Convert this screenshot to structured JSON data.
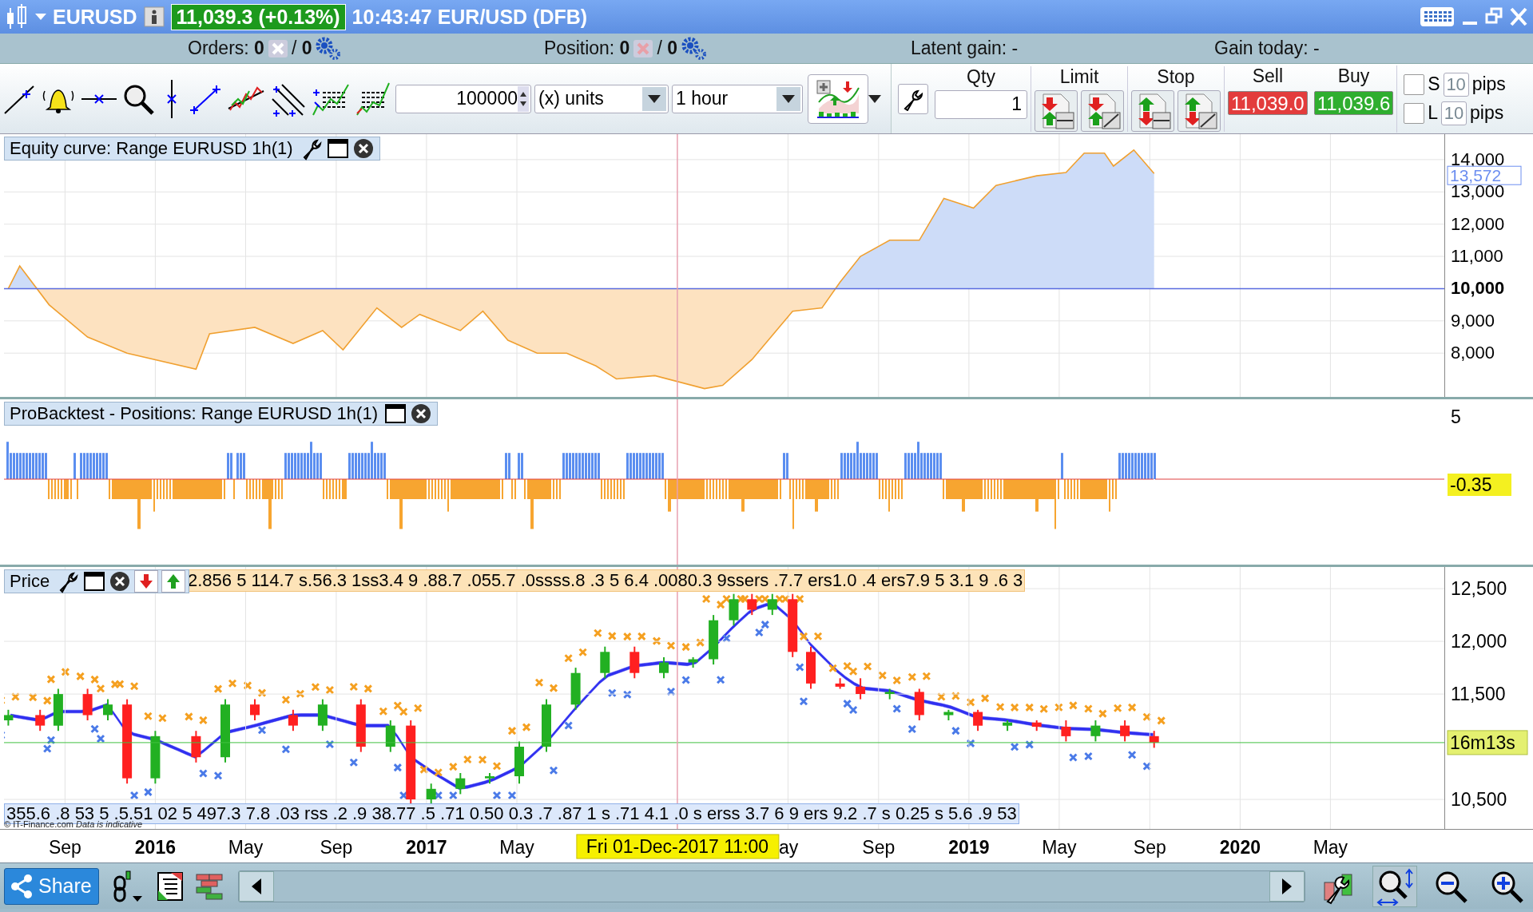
{
  "title_bar": {
    "symbol": "EURUSD",
    "price_badge": "11,039.3 (+0.13%)",
    "quote": "10:43:47 EUR/USD (DFB)"
  },
  "summary_bar": {
    "orders": {
      "text": "Orders: **0**",
      "pending": "/ **0**"
    },
    "position": {
      "text": "Position: **0**",
      "pending": "/ **0**"
    },
    "latent_gain": "Latent gain: -",
    "gain_today": "Gain today: -"
  },
  "toolbar": {
    "quantity": "100000",
    "unit": "(x) units",
    "timeframe": "1 hour"
  },
  "order_panel": {
    "qty": {
      "label": "Qty",
      "value": "1"
    },
    "limit": {
      "label": "Limit"
    },
    "stop": {
      "label": "Stop"
    },
    "sell": {
      "label": "Sell",
      "price": "11,039.0"
    },
    "buy": {
      "label": "Buy",
      "price": "11,039.6"
    },
    "protection_rows": [
      {
        "checked": false,
        "label": "S",
        "value": "10",
        "unit": "pips"
      },
      {
        "checked": false,
        "label": "L",
        "value": "10",
        "unit": "pips"
      }
    ]
  },
  "equity_panel": {
    "title": "Equity curve: Range EURUSD 1h(1)",
    "last_value": "13,572",
    "chart_data": {
      "type": "area",
      "grid": true,
      "xlim": [
        2015.442,
        2021.08
      ],
      "ylim": [
        6642,
        14790
      ],
      "x": [
        2015.458,
        2015.5,
        2015.608,
        2015.75,
        2015.896,
        2016.15,
        2016.2,
        2016.367,
        2016.508,
        2016.617,
        2016.692,
        2016.817,
        2016.908,
        2016.975,
        2017.125,
        2017.208,
        2017.3,
        2017.408,
        2017.517,
        2017.625,
        2017.7,
        2017.842,
        2018.025,
        2018.092,
        2018.2,
        2018.35,
        2018.458,
        2018.525,
        2018.6,
        2018.708,
        2018.817,
        2018.908,
        2019.017,
        2019.1,
        2019.25,
        2019.358,
        2019.425,
        2019.5,
        2019.533,
        2019.608,
        2019.683
      ],
      "series": [
        {
          "color": "#f0a030",
          "values": [
            10000,
            10700,
            9500,
            8500,
            8000,
            7500,
            8600,
            8800,
            8300,
            8700,
            8100,
            9400,
            8800,
            9200,
            8700,
            9300,
            8400,
            8000,
            8000,
            7600,
            7200,
            7300,
            6900,
            7000,
            7800,
            9300,
            9400,
            10200,
            11000,
            11500,
            11500,
            12800,
            12500,
            13200,
            13500,
            13600,
            14200,
            14200,
            13800,
            14300,
            13572
          ]
        }
      ],
      "ref_lines": [
        {
          "axis": "y",
          "value": 10000
        },
        {
          "axis": "x",
          "value": 2017.925
        }
      ],
      "yticks": [
        {
          "value": 8000,
          "label": "8,000"
        },
        {
          "value": 9000,
          "label": "9,000"
        },
        {
          "value": 10000,
          "label": "10,000"
        },
        {
          "value": 11000,
          "label": "11,000"
        },
        {
          "value": 12000,
          "label": "12,000"
        },
        {
          "value": 13000,
          "label": "13,000"
        },
        {
          "value": 14000,
          "label": "14,000"
        }
      ]
    }
  },
  "positions_panel": {
    "title": "ProBacktest - Positions: Range EURUSD 1h(1)",
    "axis_label": "5",
    "current_value": "-0.35"
  },
  "price_panel": {
    "title": "Price",
    "label_strip": "2.856 5 114.7 s.56.3 1ss3.4 9 .88.7 .055.7 .0ssss.8 .3 5 6.4 .0080.3 9ssers .7.7 ers1.0 .4 ers7.9 5 3.1 9 .6 3",
    "lower_label_strip": "355.6 .8 53 5 .5.51 02 5 497.3 7.8 .03 rss .2 .9 38.77 .5 .71 0.50 0.3 .7 .87 1 s .71 4.1 .0 s erss 3.7 6 9 ers 9.2 .7 s 0.25 s 5.6 .9 53",
    "copyright": "© IT-Finance.com *Data is indicative*",
    "countdown": "16m13s",
    "crosshair_label": "Fri 01-Dec-2017 11:00",
    "chart_data": {
      "type": "candlestick",
      "grid": true,
      "xlim": [
        2015.442,
        2021.08
      ],
      "ylim": [
        10220,
        12705
      ],
      "x": [
        2015.458,
        2015.575,
        2015.642,
        2015.75,
        2015.825,
        2015.896,
        2016.0,
        2016.15,
        2016.258,
        2016.367,
        2016.508,
        2016.617,
        2016.758,
        2016.867,
        2016.942,
        2017.017,
        2017.125,
        2017.233,
        2017.342,
        2017.442,
        2017.55,
        2017.658,
        2017.767,
        2017.875,
        2017.983,
        2018.058,
        2018.133,
        2018.2,
        2018.275,
        2018.35,
        2018.417,
        2018.525,
        2018.6,
        2018.708,
        2018.817,
        2018.925,
        2019.033,
        2019.142,
        2019.25,
        2019.358,
        2019.467,
        2019.575,
        2019.683
      ],
      "ohlc": [
        [
          11250,
          11350,
          11200,
          11300
        ],
        [
          11300,
          11350,
          11150,
          11200
        ],
        [
          11200,
          11550,
          11150,
          11500
        ],
        [
          11500,
          11550,
          11250,
          11300
        ],
        [
          11300,
          11450,
          11250,
          11400
        ],
        [
          11400,
          11450,
          10650,
          10700
        ],
        [
          10700,
          11150,
          10650,
          11100
        ],
        [
          11100,
          11150,
          10850,
          10900
        ],
        [
          10900,
          11450,
          10850,
          11400
        ],
        [
          11400,
          11450,
          11250,
          11300
        ],
        [
          11300,
          11350,
          11150,
          11200
        ],
        [
          11200,
          11450,
          11150,
          11400
        ],
        [
          11400,
          11450,
          10950,
          11000
        ],
        [
          11000,
          11250,
          10950,
          11200
        ],
        [
          11200,
          11250,
          10450,
          10500
        ],
        [
          10500,
          10650,
          10450,
          10600
        ],
        [
          10600,
          10750,
          10550,
          10700
        ],
        [
          10700,
          10750,
          10650,
          10720
        ],
        [
          10720,
          11050,
          10650,
          11000
        ],
        [
          11000,
          11450,
          10950,
          11400
        ],
        [
          11400,
          11750,
          11350,
          11700
        ],
        [
          11700,
          11950,
          11650,
          11900
        ],
        [
          11900,
          11950,
          11650,
          11700
        ],
        [
          11700,
          11850,
          11650,
          11800
        ],
        [
          11800,
          11850,
          11750,
          11830
        ],
        [
          11830,
          12250,
          11780,
          12200
        ],
        [
          12200,
          12450,
          12150,
          12400
        ],
        [
          12400,
          12450,
          12250,
          12300
        ],
        [
          12300,
          12450,
          12250,
          12400
        ],
        [
          12400,
          12450,
          11850,
          11900
        ],
        [
          11900,
          11950,
          11550,
          11600
        ],
        [
          11600,
          11650,
          11550,
          11570
        ],
        [
          11570,
          11650,
          11450,
          11500
        ],
        [
          11500,
          11550,
          11450,
          11520
        ],
        [
          11520,
          11550,
          11250,
          11300
        ],
        [
          11300,
          11350,
          11250,
          11330
        ],
        [
          11330,
          11350,
          11150,
          11200
        ],
        [
          11200,
          11250,
          11150,
          11230
        ],
        [
          11230,
          11250,
          11150,
          11190
        ],
        [
          11190,
          11250,
          11050,
          11100
        ],
        [
          11100,
          11250,
          11050,
          11200
        ],
        [
          11200,
          11250,
          11050,
          11100
        ],
        [
          11100,
          11150,
          10990,
          11039
        ]
      ],
      "ref_lines": [
        {
          "axis": "x",
          "value": 2017.925
        },
        {
          "axis": "y",
          "value": 11039
        }
      ],
      "yticks": [
        {
          "value": 10500,
          "label": "10,500"
        },
        {
          "value": 11500,
          "label": "11,500"
        },
        {
          "value": 12000,
          "label": "12,000"
        },
        {
          "value": 12500,
          "label": "12,500"
        }
      ],
      "xticks": [
        {
          "value": 2015.667,
          "label": "Sep"
        },
        {
          "value": 2016,
          "label": "2016"
        },
        {
          "value": 2016.333,
          "label": "May"
        },
        {
          "value": 2016.667,
          "label": "Sep"
        },
        {
          "value": 2017,
          "label": "2017"
        },
        {
          "value": 2017.333,
          "label": "May"
        },
        {
          "value": 2018.333,
          "label": "ay"
        },
        {
          "value": 2018.667,
          "label": "Sep"
        },
        {
          "value": 2019,
          "label": "2019"
        },
        {
          "value": 2019.333,
          "label": "May"
        },
        {
          "value": 2019.667,
          "label": "Sep"
        },
        {
          "value": 2020,
          "label": "2020"
        },
        {
          "value": 2020.333,
          "label": "May"
        }
      ]
    }
  },
  "bottom_bar": {
    "share": "Share"
  }
}
